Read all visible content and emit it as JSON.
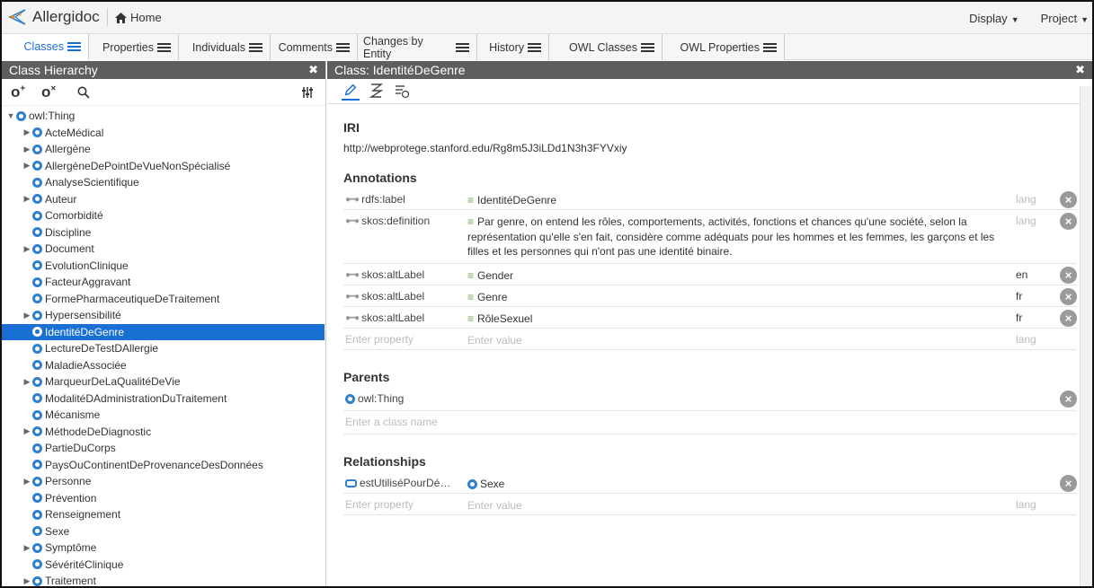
{
  "app": {
    "title": "Allergidoc",
    "home": "Home",
    "display": "Display",
    "project": "Project"
  },
  "tabs": [
    "Classes",
    "Properties",
    "Individuals",
    "Comments",
    "Changes by Entity",
    "History",
    "OWL Classes",
    "OWL Properties"
  ],
  "left_panel": {
    "title": "Class Hierarchy",
    "tree": [
      {
        "label": "owl:Thing",
        "depth": 0,
        "expand": "open"
      },
      {
        "label": "ActeMédical",
        "depth": 1,
        "expand": "closed"
      },
      {
        "label": "Allergène",
        "depth": 1,
        "expand": "closed"
      },
      {
        "label": "AllergèneDePointDeVueNonSpécialisé",
        "depth": 1,
        "expand": "closed"
      },
      {
        "label": "AnalyseScientifique",
        "depth": 1,
        "expand": "none"
      },
      {
        "label": "Auteur",
        "depth": 1,
        "expand": "closed"
      },
      {
        "label": "Comorbidité",
        "depth": 1,
        "expand": "none"
      },
      {
        "label": "Discipline",
        "depth": 1,
        "expand": "none"
      },
      {
        "label": "Document",
        "depth": 1,
        "expand": "closed"
      },
      {
        "label": "EvolutionClinique",
        "depth": 1,
        "expand": "none"
      },
      {
        "label": "FacteurAggravant",
        "depth": 1,
        "expand": "none"
      },
      {
        "label": "FormePharmaceutiqueDeTraitement",
        "depth": 1,
        "expand": "none"
      },
      {
        "label": "Hypersensibilité",
        "depth": 1,
        "expand": "closed"
      },
      {
        "label": "IdentitéDeGenre",
        "depth": 1,
        "expand": "none",
        "selected": true
      },
      {
        "label": "LectureDeTestDAllergie",
        "depth": 1,
        "expand": "none"
      },
      {
        "label": "MaladieAssociée",
        "depth": 1,
        "expand": "none"
      },
      {
        "label": "MarqueurDeLaQualitéDeVie",
        "depth": 1,
        "expand": "closed"
      },
      {
        "label": "ModalitéDAdministrationDuTraitement",
        "depth": 1,
        "expand": "none"
      },
      {
        "label": "Mécanisme",
        "depth": 1,
        "expand": "none"
      },
      {
        "label": "MéthodeDeDiagnostic",
        "depth": 1,
        "expand": "closed"
      },
      {
        "label": "PartieDuCorps",
        "depth": 1,
        "expand": "none"
      },
      {
        "label": "PaysOuContinentDeProvenanceDesDonnées",
        "depth": 1,
        "expand": "none"
      },
      {
        "label": "Personne",
        "depth": 1,
        "expand": "closed"
      },
      {
        "label": "Prévention",
        "depth": 1,
        "expand": "none"
      },
      {
        "label": "Renseignement",
        "depth": 1,
        "expand": "none"
      },
      {
        "label": "Sexe",
        "depth": 1,
        "expand": "none"
      },
      {
        "label": "Symptôme",
        "depth": 1,
        "expand": "closed"
      },
      {
        "label": "SévéritéClinique",
        "depth": 1,
        "expand": "none"
      },
      {
        "label": "Traitement",
        "depth": 1,
        "expand": "closed"
      }
    ]
  },
  "right_panel": {
    "title": "Class: IdentitéDeGenre",
    "iri_label": "IRI",
    "iri": "http://webprotege.stanford.edu/Rg8m5J3iLDd1N3h3FYVxiy",
    "annotations_label": "Annotations",
    "annotations": [
      {
        "property": "rdfs:label",
        "value": "IdentitéDeGenre",
        "lang": "lang",
        "lang_placeholder": true
      },
      {
        "property": "skos:definition",
        "value": "Par genre, on entend les rôles, comportements, activités, fonctions et chances qu'une société, selon la représentation qu'elle s'en fait, considère comme adéquats pour les hommes et les femmes, les garçons et les filles et les personnes qui n'ont pas une identité binaire.",
        "lang": "lang",
        "lang_placeholder": true
      },
      {
        "property": "skos:altLabel",
        "value": "Gender",
        "lang": "en",
        "lang_placeholder": false
      },
      {
        "property": "skos:altLabel",
        "value": "Genre",
        "lang": "fr",
        "lang_placeholder": false
      },
      {
        "property": "skos:altLabel",
        "value": "RôleSexuel",
        "lang": "fr",
        "lang_placeholder": false
      }
    ],
    "enter_property": "Enter property",
    "enter_value": "Enter value",
    "lang_placeholder": "lang",
    "parents_label": "Parents",
    "parent": "owl:Thing",
    "enter_class": "Enter a class name",
    "relationships_label": "Relationships",
    "relationship": {
      "property": "estUtiliséPourDé…",
      "value": "Sexe"
    }
  }
}
